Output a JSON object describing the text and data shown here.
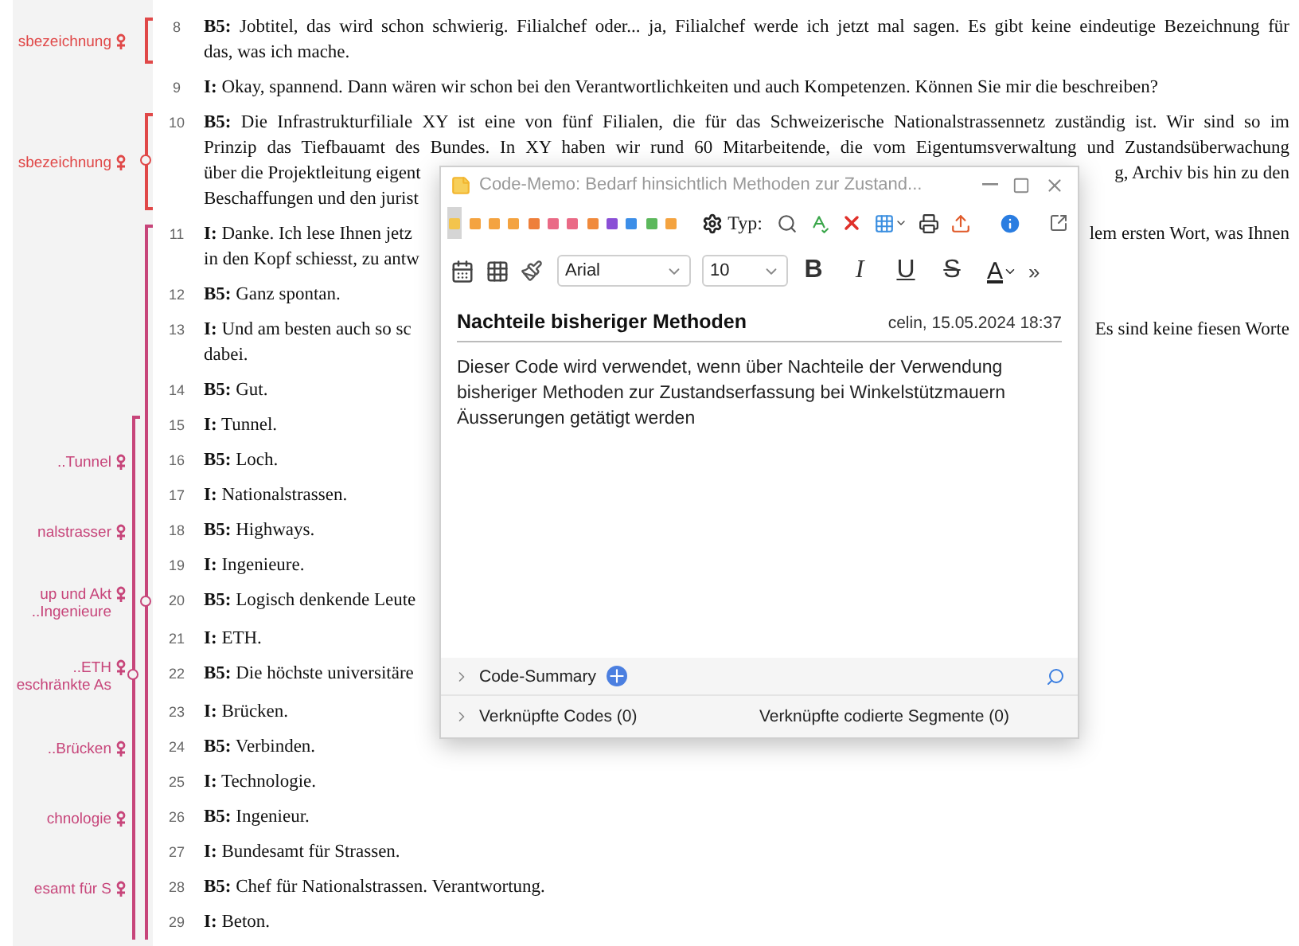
{
  "transcript": {
    "rows": [
      {
        "number": "8",
        "speaker": "B5:",
        "lines": [
          "Jobtitel, das wird schon schwierig. Filialchef oder... ja, Filialchef werde ich jetzt mal sagen. Es gibt keine eindeutige Bezeichnung für",
          "das, was ich mache."
        ],
        "codes": [
          {
            "label": "sbezeichnung",
            "symbol": true,
            "color": "#e04848"
          }
        ],
        "inner": {
          "continues_above": false,
          "continues_below": false,
          "node": false,
          "color": "#e04848"
        }
      },
      {
        "number": "9",
        "speaker": "I:",
        "lines": [
          "Okay, spannend. Dann wären wir schon bei den Verantwortlichkeiten und auch Kompetenzen. Können Sie mir die beschreiben?"
        ],
        "codes": []
      },
      {
        "number": "10",
        "speaker": "B5:",
        "lines": [
          "Die Infrastrukturfiliale XY ist eine von fünf Filialen, die für das Schweizerische Nationalstrassennetz zuständig ist. Wir sind so im",
          "Prinzip das Tiefbauamt des Bundes. In XY haben wir rund 60 Mitarbeitende, die vom Eigentumsverwaltung und Zustandsüberwachung",
          {
            "left": "über die Projektleitung eigent",
            "right": "g, Archiv bis hin zu den"
          },
          {
            "left": "Beschaffungen und den jurist"
          }
        ],
        "codes": [
          {
            "label": "sbezeichnung",
            "symbol": true,
            "color": "#e04848"
          }
        ],
        "inner": {
          "continues_above": false,
          "continues_below": false,
          "node": true,
          "color": "#e04848"
        }
      },
      {
        "number": "11",
        "speaker": "I:",
        "lines": [
          {
            "left": "Danke. Ich lese Ihnen jetz",
            "right": "lem ersten Wort, was Ihnen"
          },
          {
            "left": "in den Kopf schiesst, zu antw"
          }
        ],
        "codes": [],
        "inner": {
          "continues_above": false,
          "continues_below": true,
          "node": false,
          "color": "#c7457a"
        }
      },
      {
        "number": "12",
        "speaker": "B5:",
        "lines": [
          "Ganz spontan."
        ],
        "codes": [],
        "inner": {
          "continues_above": true,
          "continues_below": true,
          "node": false,
          "color": "#c7457a"
        }
      },
      {
        "number": "13",
        "speaker": "I:",
        "lines": [
          {
            "left": "Und am besten auch so sc",
            "right": "Es sind keine fiesen Worte"
          },
          "dabei."
        ],
        "codes": [],
        "inner": {
          "continues_above": true,
          "continues_below": true,
          "node": false,
          "color": "#c7457a"
        }
      },
      {
        "number": "14",
        "speaker": "B5:",
        "lines": [
          "Gut."
        ],
        "codes": [],
        "inner": {
          "continues_above": true,
          "continues_below": true,
          "node": false,
          "color": "#c7457a"
        }
      },
      {
        "number": "15",
        "speaker": "I:",
        "lines": [
          "Tunnel."
        ],
        "codes": [],
        "outer": {
          "continues_above": false,
          "continues_below": true,
          "node": false,
          "color": "#c7457a"
        },
        "inner": {
          "continues_above": true,
          "continues_below": true,
          "node": false,
          "color": "#c7457a"
        }
      },
      {
        "number": "16",
        "speaker": "B5:",
        "lines": [
          "Loch."
        ],
        "codes": [
          {
            "label": "..Tunnel",
            "symbol": true,
            "color": "#c7457a"
          }
        ],
        "outer": {
          "continues_above": true,
          "continues_below": true,
          "node": false,
          "color": "#c7457a"
        },
        "inner": {
          "continues_above": true,
          "continues_below": true,
          "node": false,
          "color": "#c7457a"
        }
      },
      {
        "number": "17",
        "speaker": "I:",
        "lines": [
          "Nationalstrassen."
        ],
        "codes": [],
        "outer": {
          "continues_above": true,
          "continues_below": true,
          "node": false,
          "color": "#c7457a"
        },
        "inner": {
          "continues_above": true,
          "continues_below": true,
          "node": false,
          "color": "#c7457a"
        }
      },
      {
        "number": "18",
        "speaker": "B5:",
        "lines": [
          "Highways."
        ],
        "codes": [
          {
            "label": "nalstrasser",
            "symbol": true,
            "color": "#c7457a"
          }
        ],
        "outer": {
          "continues_above": true,
          "continues_below": true,
          "node": false,
          "color": "#c7457a"
        },
        "inner": {
          "continues_above": true,
          "continues_below": true,
          "node": false,
          "color": "#c7457a"
        }
      },
      {
        "number": "19",
        "speaker": "I:",
        "lines": [
          "Ingenieure."
        ],
        "codes": [],
        "outer": {
          "continues_above": true,
          "continues_below": true,
          "node": false,
          "color": "#c7457a"
        },
        "inner": {
          "continues_above": true,
          "continues_below": true,
          "node": false,
          "color": "#c7457a"
        }
      },
      {
        "number": "20",
        "speaker": "B5:",
        "lines": [
          {
            "left": "Logisch denkende Leute"
          }
        ],
        "codes": [
          {
            "label": "up und Akt",
            "symbol": true,
            "color": "#c7457a"
          },
          {
            "label": "..Ingenieure",
            "symbol": false,
            "color": "#c7457a"
          }
        ],
        "outer": {
          "continues_above": true,
          "continues_below": true,
          "node": false,
          "color": "#c7457a"
        },
        "inner": {
          "continues_above": true,
          "continues_below": true,
          "node": true,
          "color": "#c7457a"
        }
      },
      {
        "number": "21",
        "speaker": "I:",
        "lines": [
          "ETH."
        ],
        "codes": [],
        "outer": {
          "continues_above": true,
          "continues_below": true,
          "node": false,
          "color": "#c7457a"
        },
        "inner": {
          "continues_above": true,
          "continues_below": true,
          "node": false,
          "color": "#c7457a"
        }
      },
      {
        "number": "22",
        "speaker": "B5:",
        "lines": [
          {
            "left": "Die höchste universitäre"
          }
        ],
        "codes": [
          {
            "label": "..ETH",
            "symbol": true,
            "color": "#c7457a"
          },
          {
            "label": "eschränkte As",
            "symbol": false,
            "color": "#c7457a"
          }
        ],
        "outer": {
          "continues_above": true,
          "continues_below": true,
          "node": true,
          "color": "#c7457a"
        },
        "inner": {
          "continues_above": true,
          "continues_below": true,
          "node": false,
          "color": "#c7457a"
        }
      },
      {
        "number": "23",
        "speaker": "I:",
        "lines": [
          "Brücken."
        ],
        "codes": [],
        "outer": {
          "continues_above": true,
          "continues_below": true,
          "node": false,
          "color": "#c7457a"
        },
        "inner": {
          "continues_above": true,
          "continues_below": true,
          "node": false,
          "color": "#c7457a"
        }
      },
      {
        "number": "24",
        "speaker": "B5:",
        "lines": [
          "Verbinden."
        ],
        "codes": [
          {
            "label": "..Brücken",
            "symbol": true,
            "color": "#c7457a"
          }
        ],
        "outer": {
          "continues_above": true,
          "continues_below": true,
          "node": false,
          "color": "#c7457a"
        },
        "inner": {
          "continues_above": true,
          "continues_below": true,
          "node": false,
          "color": "#c7457a"
        }
      },
      {
        "number": "25",
        "speaker": "I:",
        "lines": [
          "Technologie."
        ],
        "codes": [],
        "outer": {
          "continues_above": true,
          "continues_below": true,
          "node": false,
          "color": "#c7457a"
        },
        "inner": {
          "continues_above": true,
          "continues_below": true,
          "node": false,
          "color": "#c7457a"
        }
      },
      {
        "number": "26",
        "speaker": "B5:",
        "lines": [
          "Ingenieur."
        ],
        "codes": [
          {
            "label": "chnologie",
            "symbol": true,
            "color": "#c7457a"
          }
        ],
        "outer": {
          "continues_above": true,
          "continues_below": true,
          "node": false,
          "color": "#c7457a"
        },
        "inner": {
          "continues_above": true,
          "continues_below": true,
          "node": false,
          "color": "#c7457a"
        }
      },
      {
        "number": "27",
        "speaker": "I:",
        "lines": [
          "Bundesamt für Strassen."
        ],
        "codes": [],
        "outer": {
          "continues_above": true,
          "continues_below": true,
          "node": false,
          "color": "#c7457a"
        },
        "inner": {
          "continues_above": true,
          "continues_below": true,
          "node": false,
          "color": "#c7457a"
        }
      },
      {
        "number": "28",
        "speaker": "B5:",
        "lines": [
          "Chef für Nationalstrassen. Verantwortung."
        ],
        "codes": [
          {
            "label": "esamt für S",
            "symbol": true,
            "color": "#c7457a"
          }
        ],
        "outer": {
          "continues_above": true,
          "continues_below": true,
          "node": false,
          "color": "#c7457a"
        },
        "inner": {
          "continues_above": true,
          "continues_below": true,
          "node": false,
          "color": "#c7457a"
        }
      },
      {
        "number": "29",
        "speaker": "I:",
        "lines": [
          "Beton."
        ],
        "codes": [],
        "outer": {
          "continues_above": true,
          "continues_below": true,
          "node": false,
          "color": "#c7457a"
        },
        "inner": {
          "continues_above": true,
          "continues_below": true,
          "node": false,
          "color": "#c7457a"
        }
      }
    ]
  },
  "memo": {
    "title": "Code-Memo: Bedarf hinsichtlich Methoden zur Zustand...",
    "memo_types": [
      {
        "color": "#f3c44c",
        "selected": true
      },
      {
        "color": "#f4a340",
        "selected": false
      },
      {
        "color": "#f4a340",
        "selected": false
      },
      {
        "color": "#f4a340",
        "selected": false
      },
      {
        "color": "#ee7f3a",
        "selected": false
      },
      {
        "color": "#ea6a86",
        "selected": false
      },
      {
        "color": "#ea6a86",
        "selected": false
      },
      {
        "color": "#f08a3c",
        "selected": false
      },
      {
        "color": "#8a4fd6",
        "selected": false
      },
      {
        "color": "#3c8ee8",
        "selected": false
      },
      {
        "color": "#5cb85c",
        "selected": false
      },
      {
        "color": "#f4a340",
        "selected": false
      }
    ],
    "type_label": "Typ:",
    "font": "Arial",
    "size": "10",
    "format_buttons": [
      {
        "kind": "bold",
        "label": "B"
      },
      {
        "kind": "italic",
        "label": "I"
      },
      {
        "kind": "underline",
        "label": "U"
      },
      {
        "kind": "strike",
        "label": "S"
      }
    ],
    "text_color": "A",
    "more": "»",
    "heading": "Nachteile bisheriger Methoden",
    "meta": "celin, 15.05.2024 18:37",
    "body": "Dieser Code wird verwendet, wenn über Nachteile der Verwendung bisheriger Methoden zur Zustandserfassung bei Winkelstützmauern Äusserungen getätigt werden",
    "summary_label": "Code-Summary",
    "linked_codes": "Verknüpfte Codes (0)",
    "linked_segments": "Verknüpfte codierte Segmente (0)"
  }
}
